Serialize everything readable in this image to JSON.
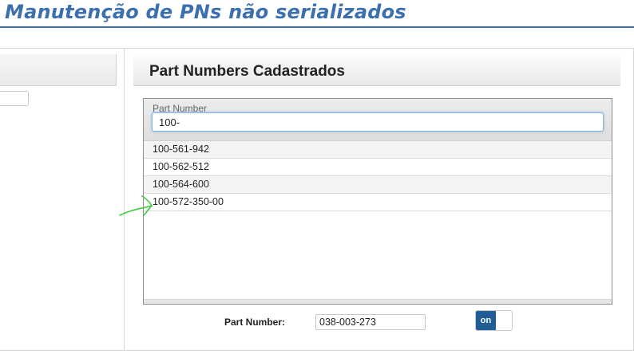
{
  "page": {
    "title": "Manutenção de PNs não serializados"
  },
  "right_panel": {
    "title": "Part Numbers Cadastrados",
    "search": {
      "label": "Part Number",
      "value": "100-"
    },
    "items": [
      {
        "label": "100-561-942"
      },
      {
        "label": "100-562-512"
      },
      {
        "label": "100-564-600"
      },
      {
        "label": "100-572-350-00"
      }
    ]
  },
  "form": {
    "part_number_label": "Part Number:",
    "part_number_value": "038-003-273",
    "toggle_label": "on"
  },
  "colors": {
    "title": "#3b6fb0",
    "toggle_on": "#1f5f96",
    "annotation": "#3fcc3f"
  }
}
